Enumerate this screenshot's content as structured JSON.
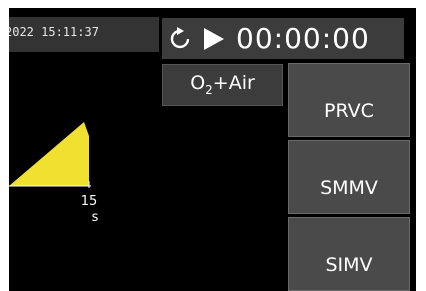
{
  "header": {
    "datetime": "2022 15:11:37"
  },
  "timer": {
    "value": "00:00:00"
  },
  "gas": {
    "label": "O2+Air"
  },
  "modes": [
    {
      "label": "PRVC"
    },
    {
      "label": "SMMV"
    },
    {
      "label": "SIMV"
    }
  ],
  "waveform": {
    "x_tick_value": "15",
    "x_unit": "s",
    "fill_color": "#f0e130"
  },
  "colors": {
    "background": "#000000",
    "panel": "#3c3c3c",
    "button": "#4a4a4a",
    "text": "#ffffff"
  }
}
